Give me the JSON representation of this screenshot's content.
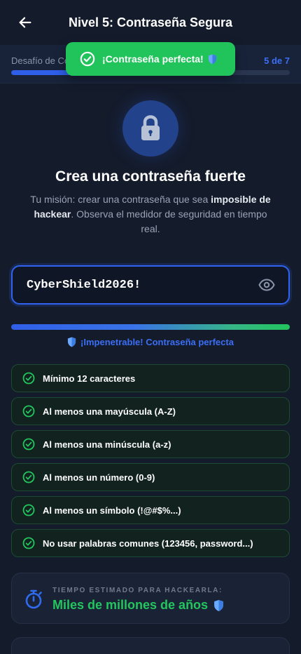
{
  "header": {
    "title": "Nivel 5: Contraseña Segura"
  },
  "progress": {
    "label": "Desafío de Contraseñas",
    "count": "5 de 7",
    "value": 0.714
  },
  "toast": {
    "text": "¡Contraseña perfecta!",
    "icon": "shield-icon"
  },
  "hero": {
    "title": "Crea una contraseña fuerte",
    "mission_prefix": "Tu misión: crear una contraseña que sea ",
    "mission_bold": "imposible de hackear",
    "mission_suffix": ". Observa el medidor de seguridad en tiempo real."
  },
  "password": {
    "value": "CyberShield2026!"
  },
  "strength": {
    "value": 1.0,
    "label": "¡Impenetrable! Contraseña perfecta"
  },
  "requirements": [
    {
      "label": "Mínimo 12 caracteres"
    },
    {
      "label": "Al menos una mayúscula (A-Z)"
    },
    {
      "label": "Al menos una minúscula (a-z)"
    },
    {
      "label": "Al menos un número (0-9)"
    },
    {
      "label": "Al menos un símbolo (!@#$%...)"
    },
    {
      "label": "No usar palabras comunes (123456, password...)"
    }
  ],
  "crack_time": {
    "label": "TIEMPO ESTIMADO PARA HACKEARLA:",
    "value": "Miles de millones de años"
  },
  "colors": {
    "accent": "#2f5fe8",
    "success": "#22c55e",
    "background": "#141b2b"
  }
}
